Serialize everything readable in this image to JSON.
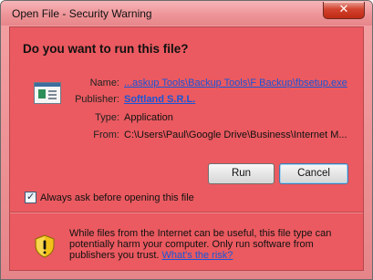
{
  "window": {
    "title": "Open File - Security Warning",
    "close_symbol": "✕"
  },
  "dialog": {
    "heading": "Do you want to run this file?",
    "fields": {
      "name_label": "Name:",
      "name_value": "...askup Tools\\Backup Tools\\F Backup\\fbsetup.exe",
      "publisher_label": "Publisher:",
      "publisher_value": "Softland S.R.L.",
      "type_label": "Type:",
      "type_value": "Application",
      "from_label": "From:",
      "from_value": "C:\\Users\\Paul\\Google Drive\\Business\\Internet M..."
    },
    "buttons": {
      "run": "Run",
      "cancel": "Cancel"
    },
    "checkbox": {
      "checked": true,
      "mark": "✓",
      "label": "Always ask before opening this file"
    },
    "warning": {
      "text": "While files from the Internet can be useful, this file type can potentially harm your computer. Only run software from publishers you trust. ",
      "link": "What's the risk?"
    }
  },
  "colors": {
    "dialog_background": "#ea5a60",
    "link": "#1a55d6",
    "close_button": "#c7402c"
  },
  "icons": [
    "application-file-icon",
    "security-shield-icon",
    "close-icon",
    "checkmark-icon"
  ]
}
